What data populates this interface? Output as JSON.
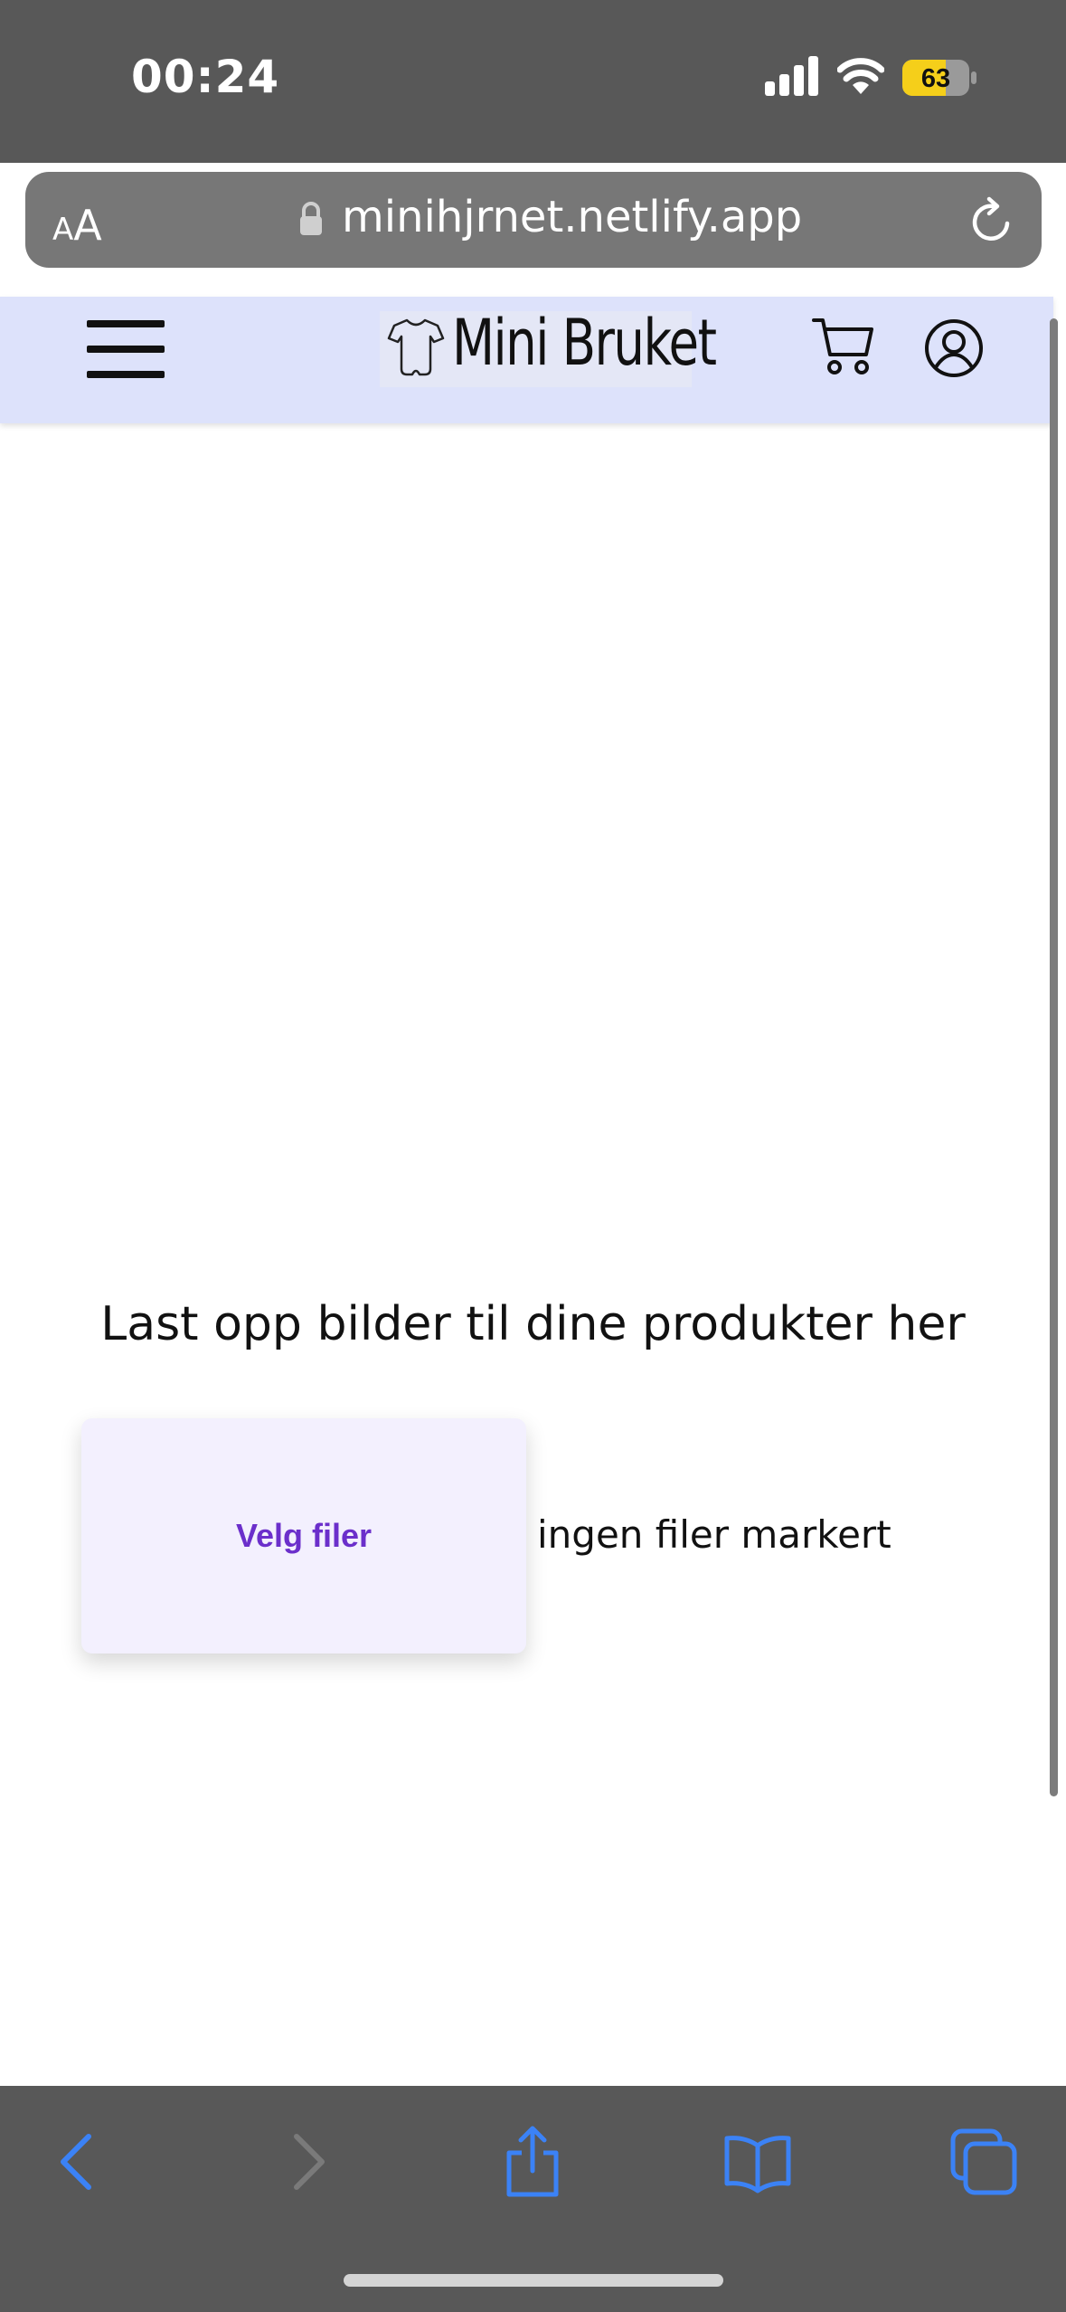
{
  "status_bar": {
    "time": "00:24",
    "battery": "63",
    "icons": [
      "signal-icon",
      "wifi-icon",
      "battery-icon"
    ]
  },
  "browser": {
    "text_size_button": {
      "small": "A",
      "large": "A"
    },
    "url": "minihjrnet.netlify.app",
    "icons": [
      "lock-icon",
      "reload-icon"
    ]
  },
  "site_header": {
    "logo_text": "Mini Bruket",
    "icons": [
      "hamburger-menu-icon",
      "onesie-icon",
      "cart-icon",
      "account-icon"
    ],
    "background": "#dde2fb"
  },
  "main": {
    "title": "Last opp bilder til dine produkter her",
    "file_button_label": "Velg filer",
    "file_status": "ingen filer markert",
    "accent_color": "#6b2fcb"
  },
  "toolbar": {
    "icons": [
      "back-icon",
      "forward-icon",
      "share-icon",
      "bookmarks-icon",
      "tabs-icon"
    ],
    "accent_color": "#3b82f6"
  }
}
